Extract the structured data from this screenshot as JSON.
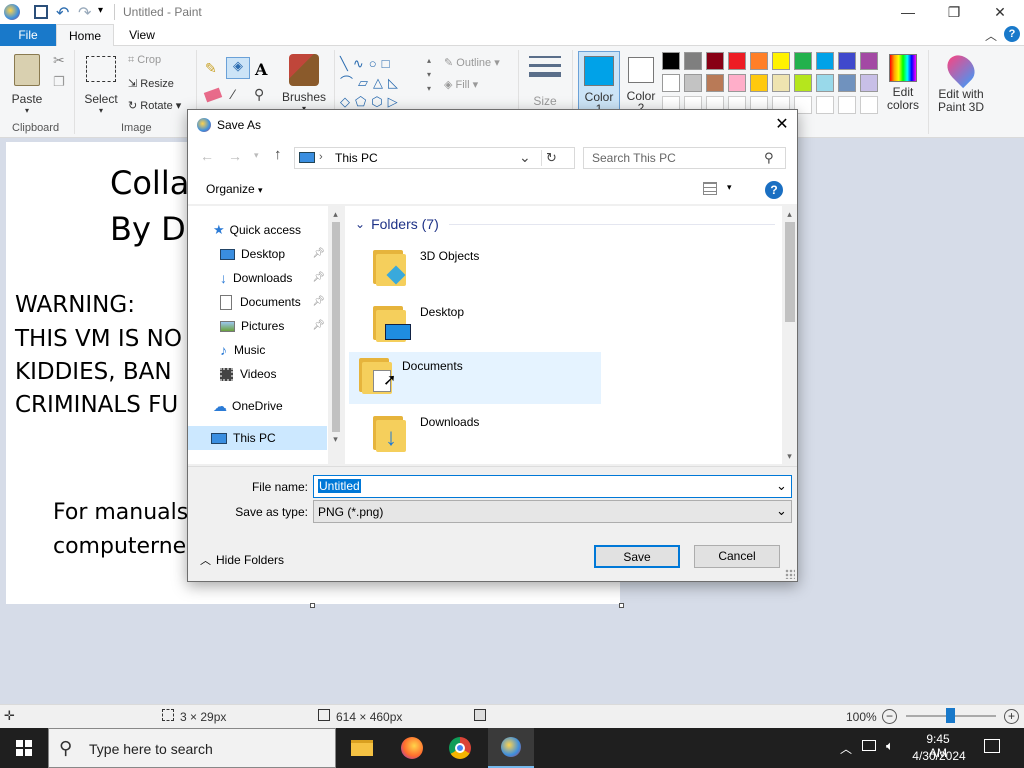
{
  "app": {
    "window_title": "Untitled - Paint"
  },
  "ribbon": {
    "tabs": [
      {
        "label": "File"
      },
      {
        "label": "Home"
      },
      {
        "label": "View"
      }
    ],
    "clipboard": {
      "paste": "Paste",
      "group": "Clipboard"
    },
    "image": {
      "select": "Select",
      "crop": "Crop",
      "resize": "Resize",
      "rotate": "Rotate",
      "group": "Image"
    },
    "brushes": "Brushes",
    "shapes": {
      "outline": "Outline",
      "fill": "Fill"
    },
    "size": "Size",
    "color1": "Color",
    "color1_num": "1",
    "color2": "Color",
    "color2_num": "2",
    "edit_colors": "Edit colors",
    "edit_paint3d": "Edit with Paint 3D",
    "palette": [
      "#000000",
      "#7f7f7f",
      "#880015",
      "#ed1c24",
      "#ff7f27",
      "#fff200",
      "#22b14c",
      "#00a2e8",
      "#3f48cc",
      "#a349a4",
      "#ffffff",
      "#c3c3c3",
      "#b97a57",
      "#ffaec9",
      "#ffc90e",
      "#efe4b0",
      "#b5e61d",
      "#99d9ea",
      "#7092be",
      "#c8bfe7"
    ]
  },
  "canvas": {
    "line1": "Collab",
    "line2": "By Do",
    "warning1": "WARNING:",
    "warning2": "THIS VM IS NO",
    "warning3": "KIDDIES, BAN",
    "warning4": "CRIMINALS FU",
    "manual1": "For manuals",
    "manual2": "computernew"
  },
  "status": {
    "selection": "3 × 29px",
    "image_size": "614 × 460px",
    "zoom": "100%"
  },
  "dialog": {
    "title": "Save As",
    "address": "This PC",
    "search_placeholder": "Search This PC",
    "organize": "Organize",
    "nav": [
      {
        "label": "Quick access"
      },
      {
        "label": "Desktop"
      },
      {
        "label": "Downloads"
      },
      {
        "label": "Documents"
      },
      {
        "label": "Pictures"
      },
      {
        "label": "Music"
      },
      {
        "label": "Videos"
      },
      {
        "label": "OneDrive"
      },
      {
        "label": "This PC"
      }
    ],
    "folders_header": "Folders (7)",
    "folders": [
      {
        "label": "3D Objects"
      },
      {
        "label": "Desktop"
      },
      {
        "label": "Documents"
      },
      {
        "label": "Downloads"
      }
    ],
    "file_name_label": "File name:",
    "file_name_value": "Untitled",
    "save_type_label": "Save as type:",
    "save_type_value": "PNG (*.png)",
    "hide_folders": "Hide Folders",
    "save": "Save",
    "cancel": "Cancel"
  },
  "taskbar": {
    "search_placeholder": "Type here to search",
    "time": "9:45 AM",
    "date": "4/30/2024"
  },
  "colors": {
    "accent": "#0078d7",
    "taskbar": "#1f1f1f"
  }
}
